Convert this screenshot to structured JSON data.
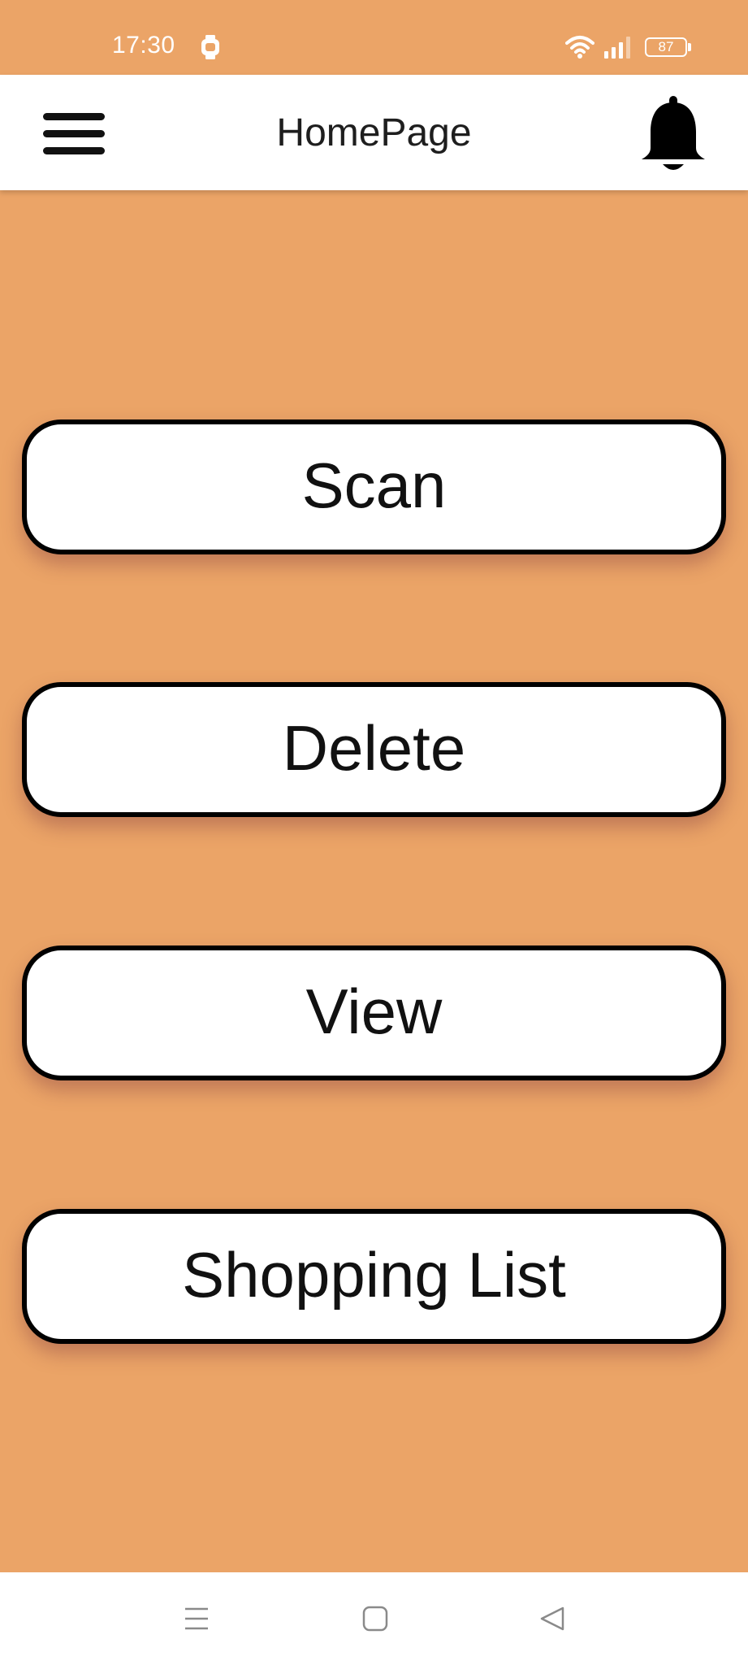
{
  "status_bar": {
    "time": "17:30",
    "battery_level": "87",
    "icons": [
      "watch-icon",
      "wifi-icon",
      "signal-icon",
      "battery-icon"
    ]
  },
  "app_bar": {
    "title": "HomePage",
    "menu_icon": "hamburger-menu-icon",
    "notification_icon": "bell-icon"
  },
  "actions": {
    "scan_label": "Scan",
    "delete_label": "Delete",
    "view_label": "View",
    "shopping_list_label": "Shopping List"
  },
  "nav_bar": {
    "icons": [
      "recent-apps-icon",
      "home-icon",
      "back-icon"
    ]
  },
  "colors": {
    "background": "#eba467",
    "app_bar": "#ffffff",
    "button_fill": "#ffffff",
    "button_border": "#000000",
    "text": "#111111"
  }
}
